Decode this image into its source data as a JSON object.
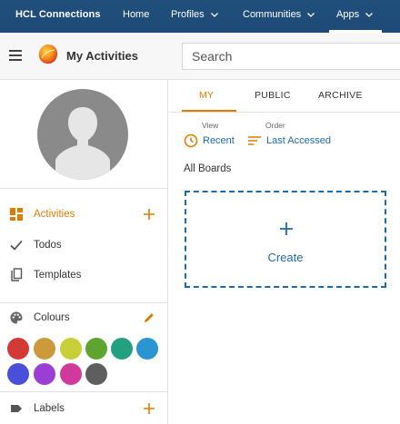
{
  "topnav": {
    "brand": "HCL Connections",
    "items": [
      {
        "label": "Home"
      },
      {
        "label": "Profiles"
      },
      {
        "label": "Communities"
      },
      {
        "label": "Apps"
      }
    ]
  },
  "appbar": {
    "title": "My Activities",
    "search_placeholder": "Search"
  },
  "sidebar": {
    "nav": [
      {
        "label": "Activities",
        "icon": "dashboard-icon",
        "active": true
      },
      {
        "label": "Todos",
        "icon": "checkmark-icon"
      },
      {
        "label": "Templates",
        "icon": "copy-icon"
      }
    ],
    "colours_label": "Colours",
    "colours": [
      "#d33a36",
      "#cc9a3a",
      "#c8cf37",
      "#5fa331",
      "#22a07f",
      "#2a95d2",
      "#4a4fd9",
      "#9b3fd4",
      "#cf3a9b",
      "#5e5e5e"
    ],
    "labels_label": "Labels"
  },
  "main": {
    "tabs": [
      {
        "label": "MY",
        "active": true
      },
      {
        "label": "PUBLIC"
      },
      {
        "label": "ARCHIVE"
      }
    ],
    "view_caption": "View",
    "view_value": "Recent",
    "order_caption": "Order",
    "order_value": "Last Accessed",
    "boards_title": "All Boards",
    "create_label": "Create"
  },
  "colors": {
    "accent": "#e07b00",
    "link": "#1c6aa8",
    "nav_bg": "#1f4e79"
  }
}
